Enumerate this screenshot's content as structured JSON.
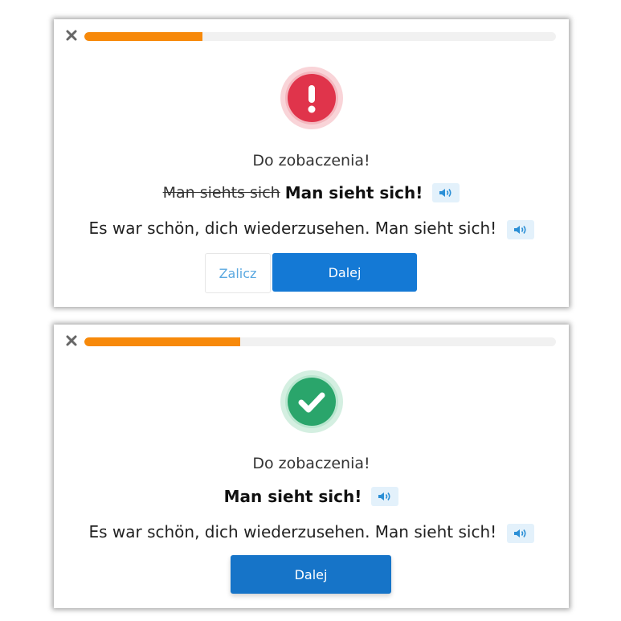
{
  "cards": [
    {
      "status": "error",
      "progress_fraction": 0.25,
      "prompt": "Do zobaczenia!",
      "wrong_answer": "Man siehts sich",
      "correct_answer": "Man sieht sich!",
      "sentence": "Es war schön, dich wiederzusehen. Man sieht sich!",
      "buttons": {
        "secondary": "Zalicz",
        "primary": "Dalej"
      }
    },
    {
      "status": "success",
      "progress_fraction": 0.33,
      "prompt": "Do zobaczenia!",
      "correct_answer": "Man sieht sich!",
      "sentence": "Es war schön, dich wiederzusehen. Man sieht sich!",
      "buttons": {
        "primary": "Dalej"
      }
    }
  ],
  "colors": {
    "progress": "#f7890a",
    "error": "#e0344b",
    "success": "#2aa56b",
    "primary": "#1479d5",
    "audio_bg": "#e3f1fb",
    "audio_icon": "#2b8fd6"
  },
  "icons": {
    "close": "close-icon",
    "error": "exclamation-icon",
    "success": "checkmark-icon",
    "audio": "speaker-icon"
  }
}
